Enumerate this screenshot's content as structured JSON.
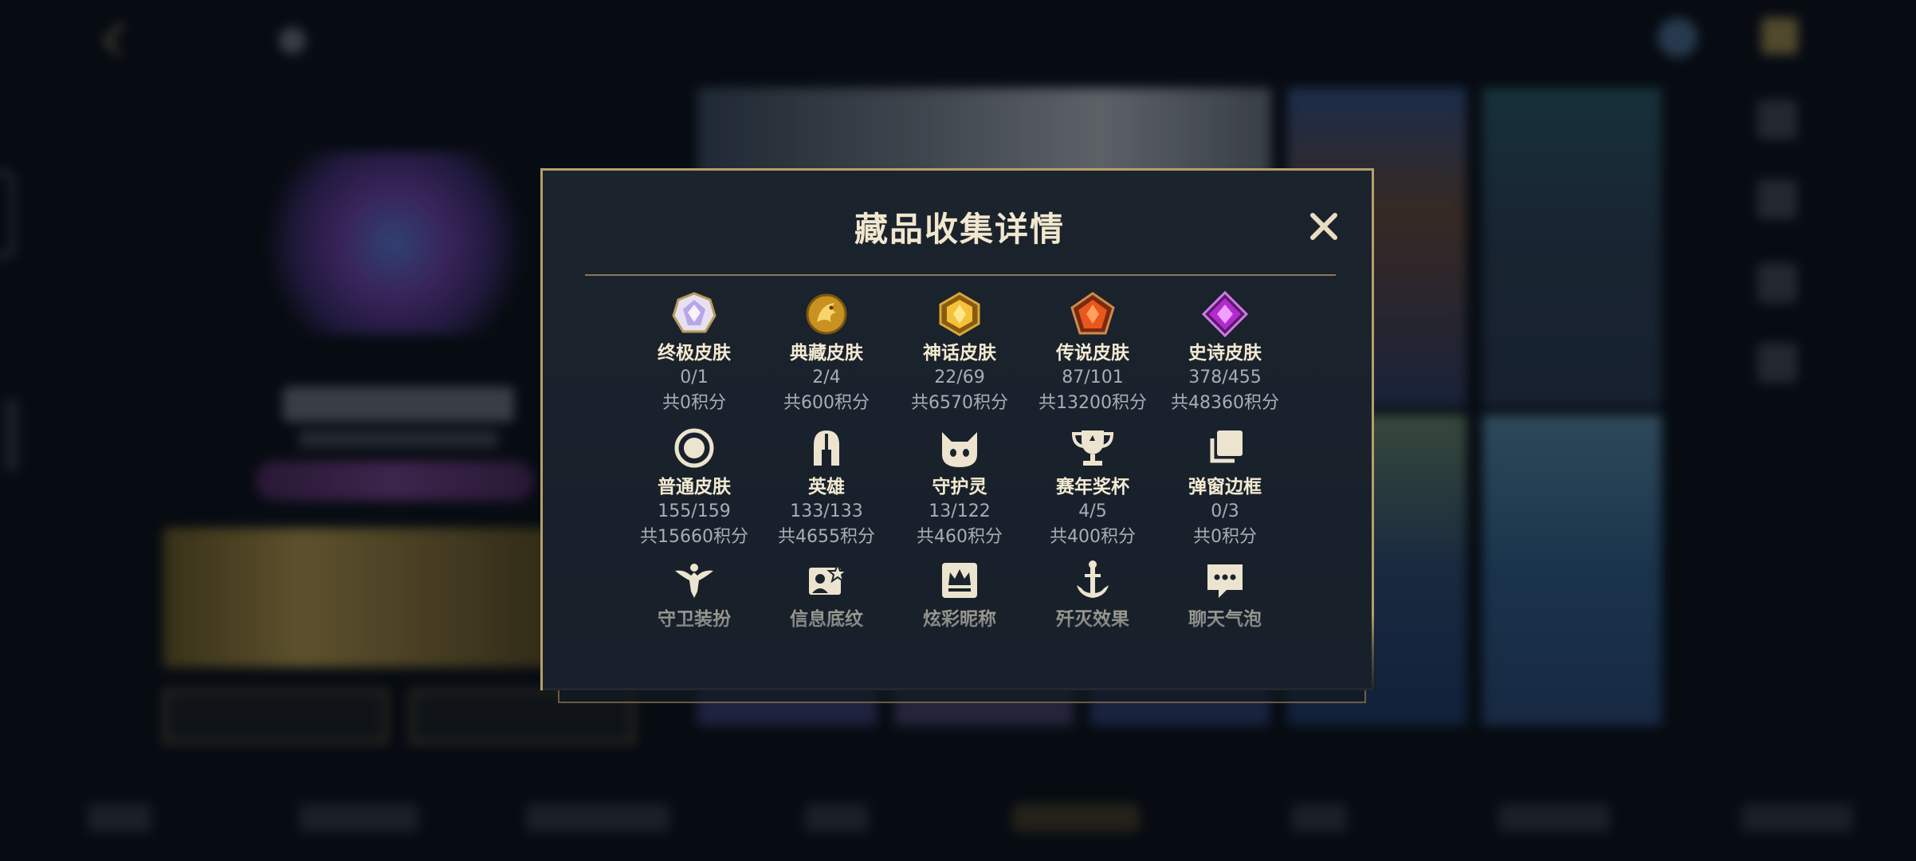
{
  "modal": {
    "title": "藏品收集详情",
    "close_label": "✕"
  },
  "rows": [
    [
      {
        "name": "终极皮肤",
        "count": "0/1",
        "points": "共0积分",
        "icon": "ultimate-skin-gem-icon"
      },
      {
        "name": "典藏皮肤",
        "count": "2/4",
        "points": "共600积分",
        "icon": "collection-skin-dragon-icon"
      },
      {
        "name": "神话皮肤",
        "count": "22/69",
        "points": "共6570积分",
        "icon": "mythic-skin-gem-icon"
      },
      {
        "name": "传说皮肤",
        "count": "87/101",
        "points": "共13200积分",
        "icon": "legendary-skin-gem-icon"
      },
      {
        "name": "史诗皮肤",
        "count": "378/455",
        "points": "共48360积分",
        "icon": "epic-skin-gem-icon"
      }
    ],
    [
      {
        "name": "普通皮肤",
        "count": "155/159",
        "points": "共15660积分",
        "icon": "normal-skin-circle-icon"
      },
      {
        "name": "英雄",
        "count": "133/133",
        "points": "共4655积分",
        "icon": "hero-helmet-icon"
      },
      {
        "name": "守护灵",
        "count": "13/122",
        "points": "共460积分",
        "icon": "guardian-spirit-icon"
      },
      {
        "name": "赛年奖杯",
        "count": "4/5",
        "points": "共400积分",
        "icon": "trophy-icon"
      },
      {
        "name": "弹窗边框",
        "count": "0/3",
        "points": "共0积分",
        "icon": "popup-frame-icon"
      }
    ],
    [
      {
        "name": "守卫装扮",
        "icon": "ward-skin-icon"
      },
      {
        "name": "信息底纹",
        "icon": "info-background-icon"
      },
      {
        "name": "炫彩昵称",
        "icon": "colorful-nickname-icon"
      },
      {
        "name": "歼灭效果",
        "icon": "annihilation-effect-icon"
      },
      {
        "name": "聊天气泡",
        "icon": "chat-bubble-icon"
      }
    ]
  ],
  "colors": {
    "gold_border": "#b79f69",
    "title": "#f1e7cf",
    "muted_text": "#a8adb6",
    "panel": "#1b232d"
  }
}
